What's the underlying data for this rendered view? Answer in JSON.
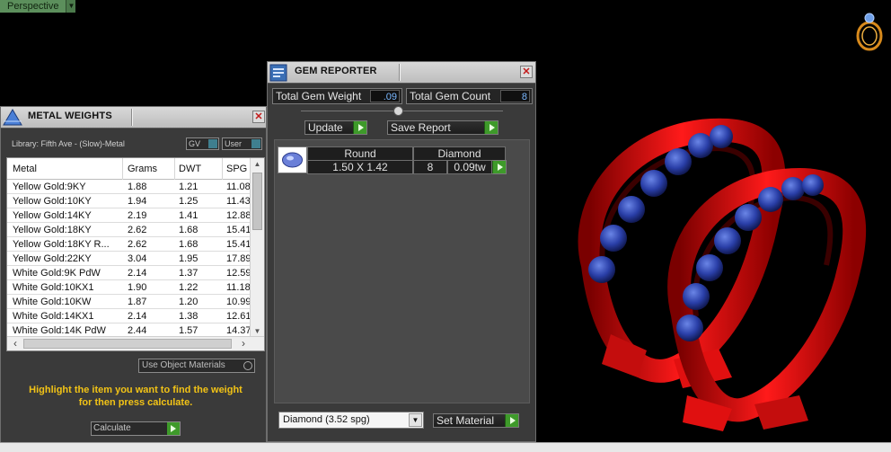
{
  "viewport": {
    "view_label": "Perspective"
  },
  "metal_weights": {
    "title": "METAL WEIGHTS",
    "library": "Library: Fifth Ave - (Slow)-Metal",
    "toggle_gv": "GV",
    "toggle_user": "User",
    "columns": [
      "Metal",
      "Grams",
      "DWT",
      "SPG"
    ],
    "rows": [
      [
        "Yellow Gold:9KY",
        "1.88",
        "1.21",
        "11.08"
      ],
      [
        "Yellow Gold:10KY",
        "1.94",
        "1.25",
        "11.43"
      ],
      [
        "Yellow Gold:14KY",
        "2.19",
        "1.41",
        "12.88"
      ],
      [
        "Yellow Gold:18KY",
        "2.62",
        "1.68",
        "15.41"
      ],
      [
        "Yellow Gold:18KY R...",
        "2.62",
        "1.68",
        "15.41"
      ],
      [
        "Yellow Gold:22KY",
        "3.04",
        "1.95",
        "17.89"
      ],
      [
        "White Gold:9K PdW",
        "2.14",
        "1.37",
        "12.59"
      ],
      [
        "White Gold:10KX1",
        "1.90",
        "1.22",
        "11.18"
      ],
      [
        "White Gold:10KW",
        "1.87",
        "1.20",
        "10.99"
      ],
      [
        "White Gold:14KX1",
        "2.14",
        "1.38",
        "12.61"
      ],
      [
        "White Gold:14K PdW",
        "2.44",
        "1.57",
        "14.37"
      ]
    ],
    "use_object_materials": "Use Object Materials",
    "hint_line1": "Highlight the item you want to find the weight",
    "hint_line2": "for then press calculate.",
    "calculate_label": "Calculate"
  },
  "gem_reporter": {
    "title": "GEM REPORTER",
    "total_gem_weight_label": "Total Gem Weight",
    "total_gem_weight_value": ".09",
    "total_gem_count_label": "Total Gem Count",
    "total_gem_count_value": "8",
    "update_label": "Update",
    "save_report_label": "Save Report",
    "gem_row": {
      "shape": "Round",
      "type": "Diamond",
      "size": "1.50 X 1.42",
      "count": "8",
      "weight": "0.09tw"
    },
    "material_select": "Diamond        (3.52 spg)",
    "set_material_label": "Set Material"
  },
  "colors": {
    "hint": "#f2c316",
    "go_button": "#3e9a2a",
    "metal_red": "#e01010",
    "stone_blue": "#2a3fa8"
  }
}
